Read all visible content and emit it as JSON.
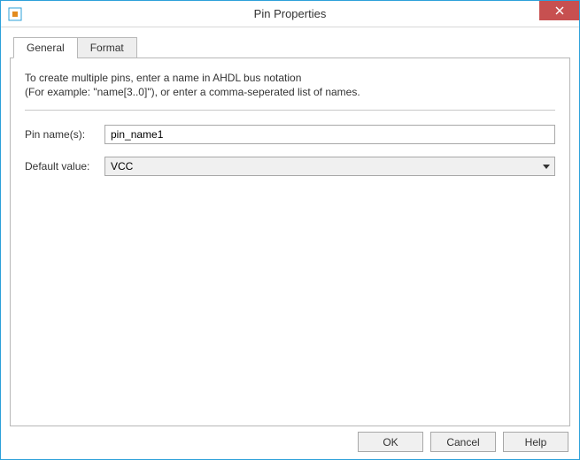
{
  "window": {
    "title": "Pin Properties"
  },
  "tabs": {
    "items": [
      {
        "label": "General"
      },
      {
        "label": "Format"
      }
    ]
  },
  "general": {
    "instructions_line1": "To create multiple pins, enter a name in AHDL bus notation",
    "instructions_line2": "(For example: \"name[3..0]\"), or enter a comma-seperated list of names.",
    "pin_name_label": "Pin name(s):",
    "pin_name_value": "pin_name1",
    "default_value_label": "Default value:",
    "default_value_selected": "VCC"
  },
  "buttons": {
    "ok": "OK",
    "cancel": "Cancel",
    "help": "Help"
  }
}
